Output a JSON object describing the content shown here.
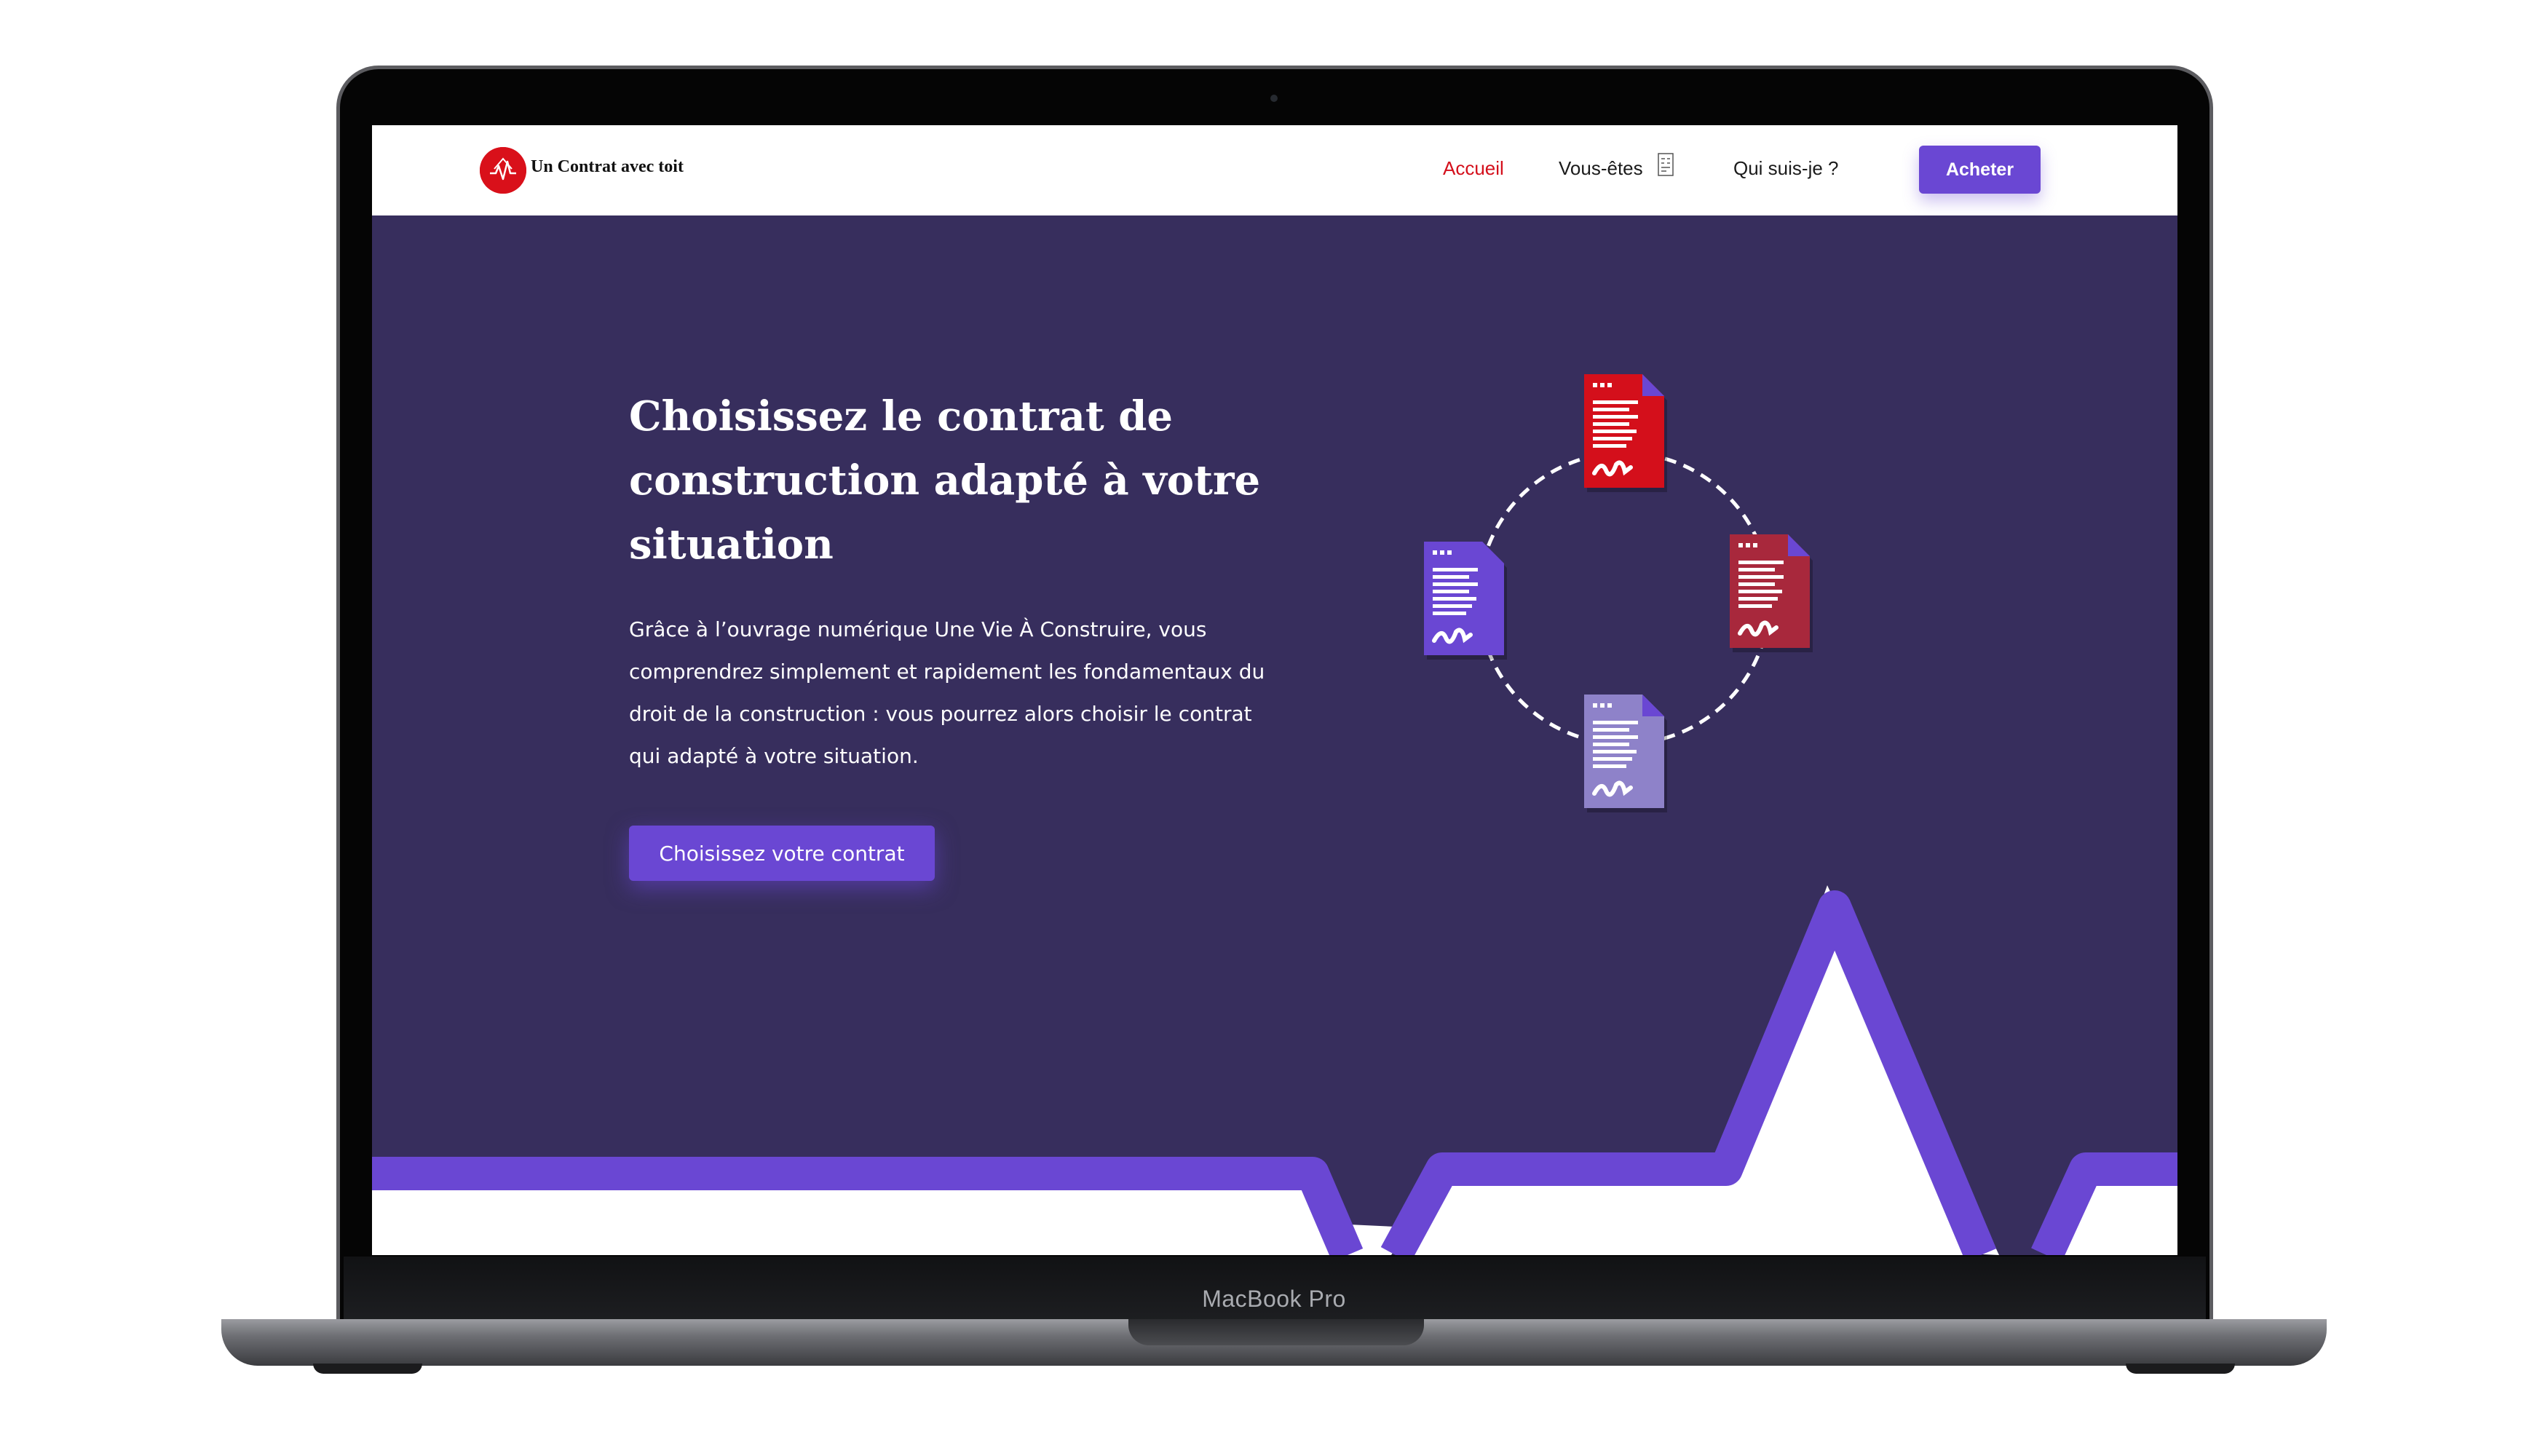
{
  "device": {
    "label": "MacBook Pro"
  },
  "header": {
    "logo_text": "Un Contrat avec toit",
    "nav": {
      "home": "Accueil",
      "you_are": "Vous-êtes",
      "about": "Qui suis-je ?"
    },
    "buy_label": "Acheter"
  },
  "hero": {
    "title_lines": [
      "Choisissez le contrat de",
      "construction adapté à votre",
      "situation"
    ],
    "paragraph_lines": [
      "Grâce à l’ouvrage numérique Une Vie À Construire, vous",
      "comprendrez simplement et rapidement les fondamentaux du",
      "droit de la construction : vous pourrez alors choisir le contrat",
      "qui adapté à votre situation."
    ],
    "cta_label": "Choisissez votre contrat"
  },
  "illustration": {
    "documents": [
      {
        "name": "top",
        "color": "#d40f1b"
      },
      {
        "name": "right",
        "color": "#a8283c"
      },
      {
        "name": "bottom",
        "color": "#8e82c9"
      },
      {
        "name": "left",
        "color": "#6a47d3"
      }
    ]
  },
  "colors": {
    "hero_bg": "#372e5d",
    "accent": "#6a47d3",
    "active_nav": "#d40f1b",
    "logo": "#d9101a"
  }
}
